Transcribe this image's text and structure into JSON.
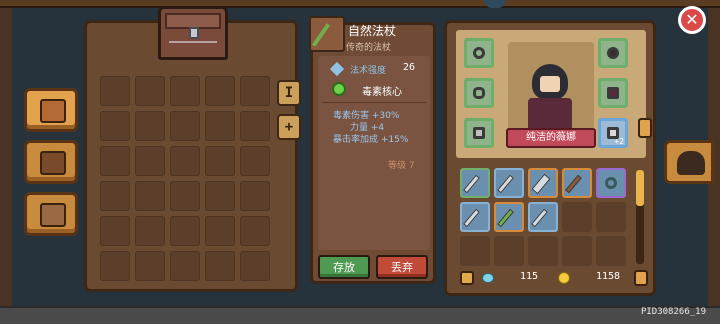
{
  "pid": "PID308266_19",
  "left_tabs": [
    {
      "name": "chest-tab",
      "icon": "treasure-chest-icon",
      "active": true
    },
    {
      "name": "quest-tab",
      "icon": "quest-book-icon",
      "active": false
    },
    {
      "name": "map-tab",
      "icon": "map-icon",
      "active": false
    }
  ],
  "mini_buttons": {
    "info": "I",
    "add": "+"
  },
  "item": {
    "name": "自然法杖",
    "rarity": "传奇的法杖",
    "proficiency_label": "法术强度",
    "proficiency_value": "26",
    "core": "毒素核心",
    "stats": [
      "毒素伤害 +30%",
      "力量 +4",
      "暴击率加成 +15%"
    ],
    "level": "等级 7",
    "store_button": "存放",
    "drop_button": "丢弃"
  },
  "character": {
    "name": "纯洁的薇娜",
    "equip_badge": "+2"
  },
  "currency": {
    "gems": "115",
    "coins": "1158"
  },
  "colors": {
    "store_green": "#4f9a52",
    "drop_red": "#c14a38",
    "name_banner": "#c14a5a"
  }
}
